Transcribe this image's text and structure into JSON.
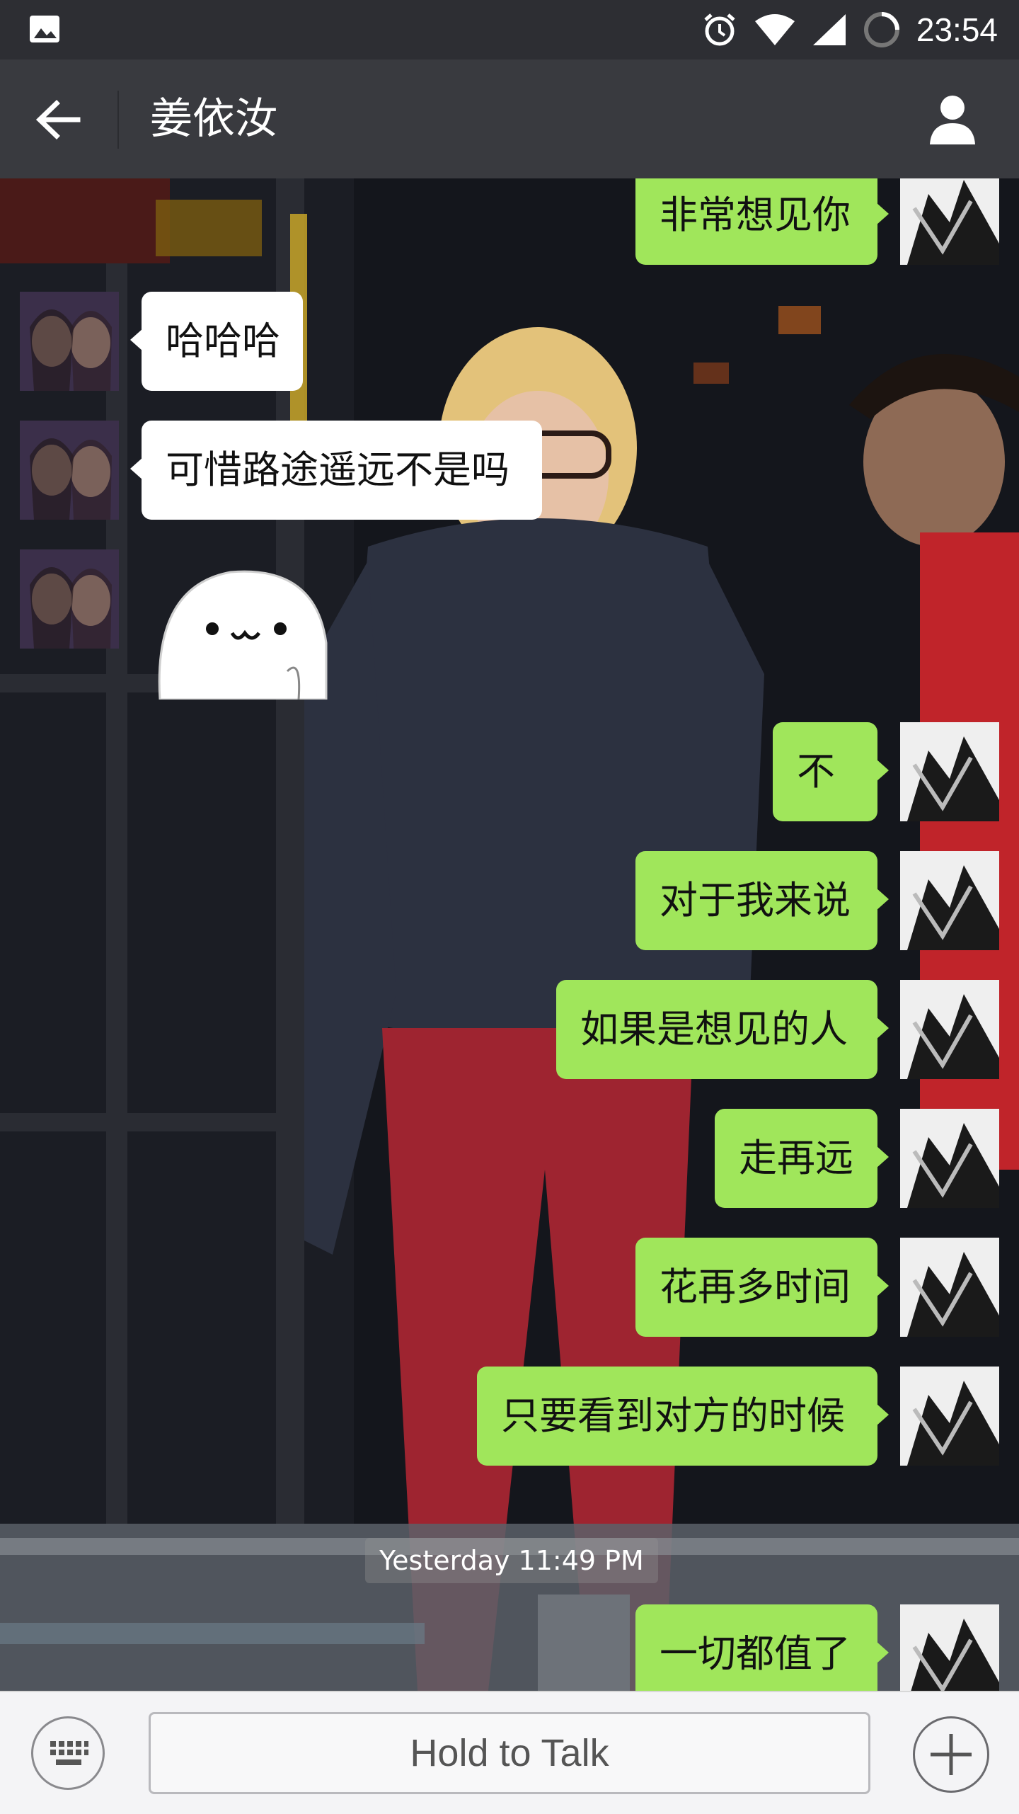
{
  "status_bar": {
    "time": "23:54",
    "icons": [
      "image-notification-icon",
      "alarm-icon",
      "wifi-icon",
      "cell-signal-icon",
      "battery-loading-icon"
    ]
  },
  "header": {
    "title": "姜依汝",
    "back_icon": "back-arrow-icon",
    "profile_icon": "person-icon"
  },
  "messages": [
    {
      "side": "right",
      "text": "非常想见你"
    },
    {
      "side": "left",
      "text": "哈哈哈"
    },
    {
      "side": "left",
      "text": "可惜路途遥远不是吗"
    },
    {
      "side": "left",
      "type": "sticker",
      "sticker": "white-blob-face-sticker"
    },
    {
      "side": "right",
      "text": "不"
    },
    {
      "side": "right",
      "text": "对于我来说"
    },
    {
      "side": "right",
      "text": "如果是想见的人"
    },
    {
      "side": "right",
      "text": "走再远"
    },
    {
      "side": "right",
      "text": "花再多时间"
    },
    {
      "side": "right",
      "text": "只要看到对方的时候"
    },
    {
      "side": "right",
      "text": "一切都值了"
    }
  ],
  "timestamp": "Yesterday 11:49 PM",
  "input_bar": {
    "keyboard_icon": "keyboard-icon",
    "talk_label": "Hold to Talk",
    "plus_icon": "plus-icon"
  },
  "colors": {
    "status_bar_bg": "#2d2e33",
    "title_bar_bg": "#393a3f",
    "bubble_right": "#a0e65b",
    "bubble_left": "#ffffff",
    "input_bar_bg": "#f4f4f6"
  }
}
